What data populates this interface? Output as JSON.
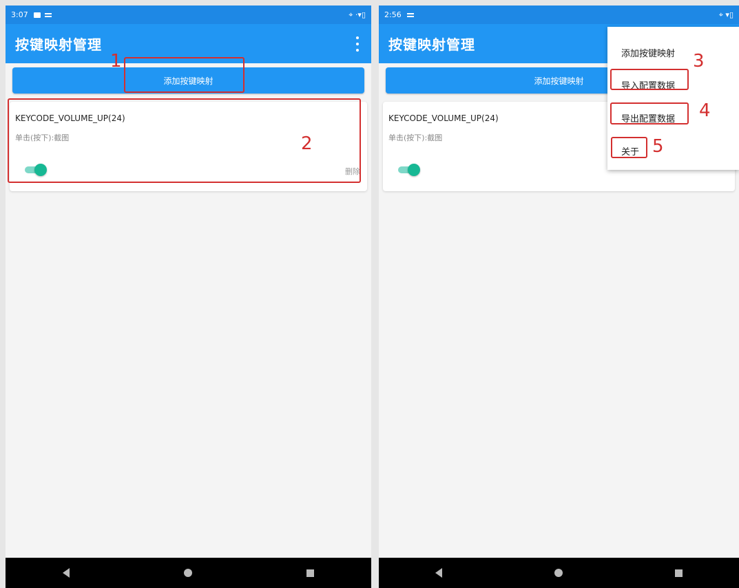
{
  "left": {
    "time": "3:07",
    "status_right": "⌖ ·▾▯",
    "app_title": "按键映射管理",
    "add_button": "添加按键映射",
    "item": {
      "keycode": "KEYCODE_VOLUME_UP(24)",
      "desc": "单击(按下):截图",
      "delete": "删除",
      "enabled": true
    }
  },
  "right": {
    "time": "2:56",
    "status_right": "⌖ ▾▯",
    "app_title": "按键映射管理",
    "add_button": "添加按键映射",
    "item": {
      "keycode": "KEYCODE_VOLUME_UP(24)",
      "desc": "单击(按下):截图",
      "enabled": true
    },
    "menu": [
      "添加按键映射",
      "导入配置数据",
      "导出配置数据",
      "关于"
    ]
  },
  "annotations": [
    "1",
    "2",
    "3",
    "4",
    "5"
  ],
  "colors": {
    "primary": "#2196f3",
    "statusbar": "#1e88e5",
    "toggle": "#17b894",
    "annotation": "#d32f2f"
  }
}
